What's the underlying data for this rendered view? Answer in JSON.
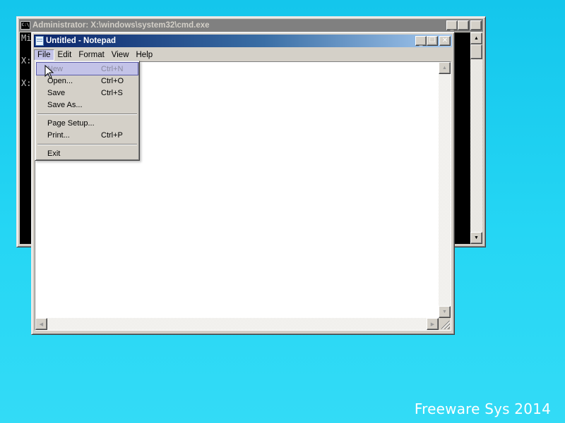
{
  "desktop": {
    "watermark": "Freeware Sys 2014"
  },
  "cmd_window": {
    "title": "Administrator: X:\\windows\\system32\\cmd.exe",
    "icon": "command-prompt-icon",
    "console_lines": [
      "Mi",
      "",
      "X:",
      "",
      "X:"
    ]
  },
  "notepad": {
    "title": "Untitled - Notepad",
    "icon": "notepad-icon",
    "menus": [
      "File",
      "Edit",
      "Format",
      "View",
      "Help"
    ],
    "active_menu": "File",
    "content": ""
  },
  "file_menu": {
    "items": [
      {
        "label": "New",
        "shortcut": "Ctrl+N"
      },
      {
        "label": "Open...",
        "shortcut": "Ctrl+O"
      },
      {
        "label": "Save",
        "shortcut": "Ctrl+S"
      },
      {
        "label": "Save As...",
        "shortcut": ""
      },
      {
        "label": "Page Setup...",
        "shortcut": ""
      },
      {
        "label": "Print...",
        "shortcut": "Ctrl+P"
      },
      {
        "label": "Exit",
        "shortcut": ""
      }
    ],
    "highlighted": "New"
  },
  "colors": {
    "desktop_bg": "#14c6ec",
    "active_title": "#0a246a",
    "inactive_title": "#808080",
    "menu_highlight": "#c3c3e8"
  }
}
